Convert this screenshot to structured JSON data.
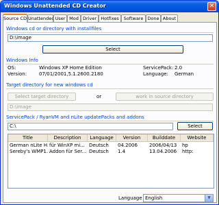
{
  "window": {
    "title": "Windows Unattended CD Creator",
    "close_label": "✕"
  },
  "tabs": [
    "Source CD",
    "Unattended",
    "User",
    "Mod",
    "Driver",
    "Hotfixes",
    "Software",
    "Done",
    "About"
  ],
  "source": {
    "group_title": "Windows cd or directory with installfiles",
    "path": "D:\\image",
    "select_label": "Select"
  },
  "info": {
    "group_title": "Windows Info",
    "os_label": "OS:",
    "os_value": "Windows XP Home Edition",
    "version_label": "Version:",
    "version_value": "07/01/2001,5.1.2600.2180",
    "sp_label": "ServicePack:",
    "sp_value": "2.0",
    "language_label": "Language:",
    "language_value": "German"
  },
  "target": {
    "group_title": "Target directory for new windows cd",
    "select_target_label": "Select target directory",
    "or_label": "or",
    "work_in_source_label": "work in source directory",
    "path": "D:\\image"
  },
  "packs": {
    "group_title": "ServicePack / RyanVM and nLite updatePacks and addons",
    "path": "C:\\",
    "select_label": "Select",
    "columns": [
      "Title",
      "Description",
      "Language",
      "Version",
      "Builddate",
      "Website"
    ],
    "rows": [
      [
        "German nLite H...",
        "für WinXP mi...",
        "Deutsch",
        "04.2006",
        "2006/04/13",
        "hp"
      ],
      [
        "Sereby's WMP1...",
        "Addon für Ser...",
        "Deutsch",
        "1.4",
        "13.04.2006",
        "http:"
      ]
    ]
  },
  "language_select": {
    "label": "Language",
    "value": "English"
  }
}
